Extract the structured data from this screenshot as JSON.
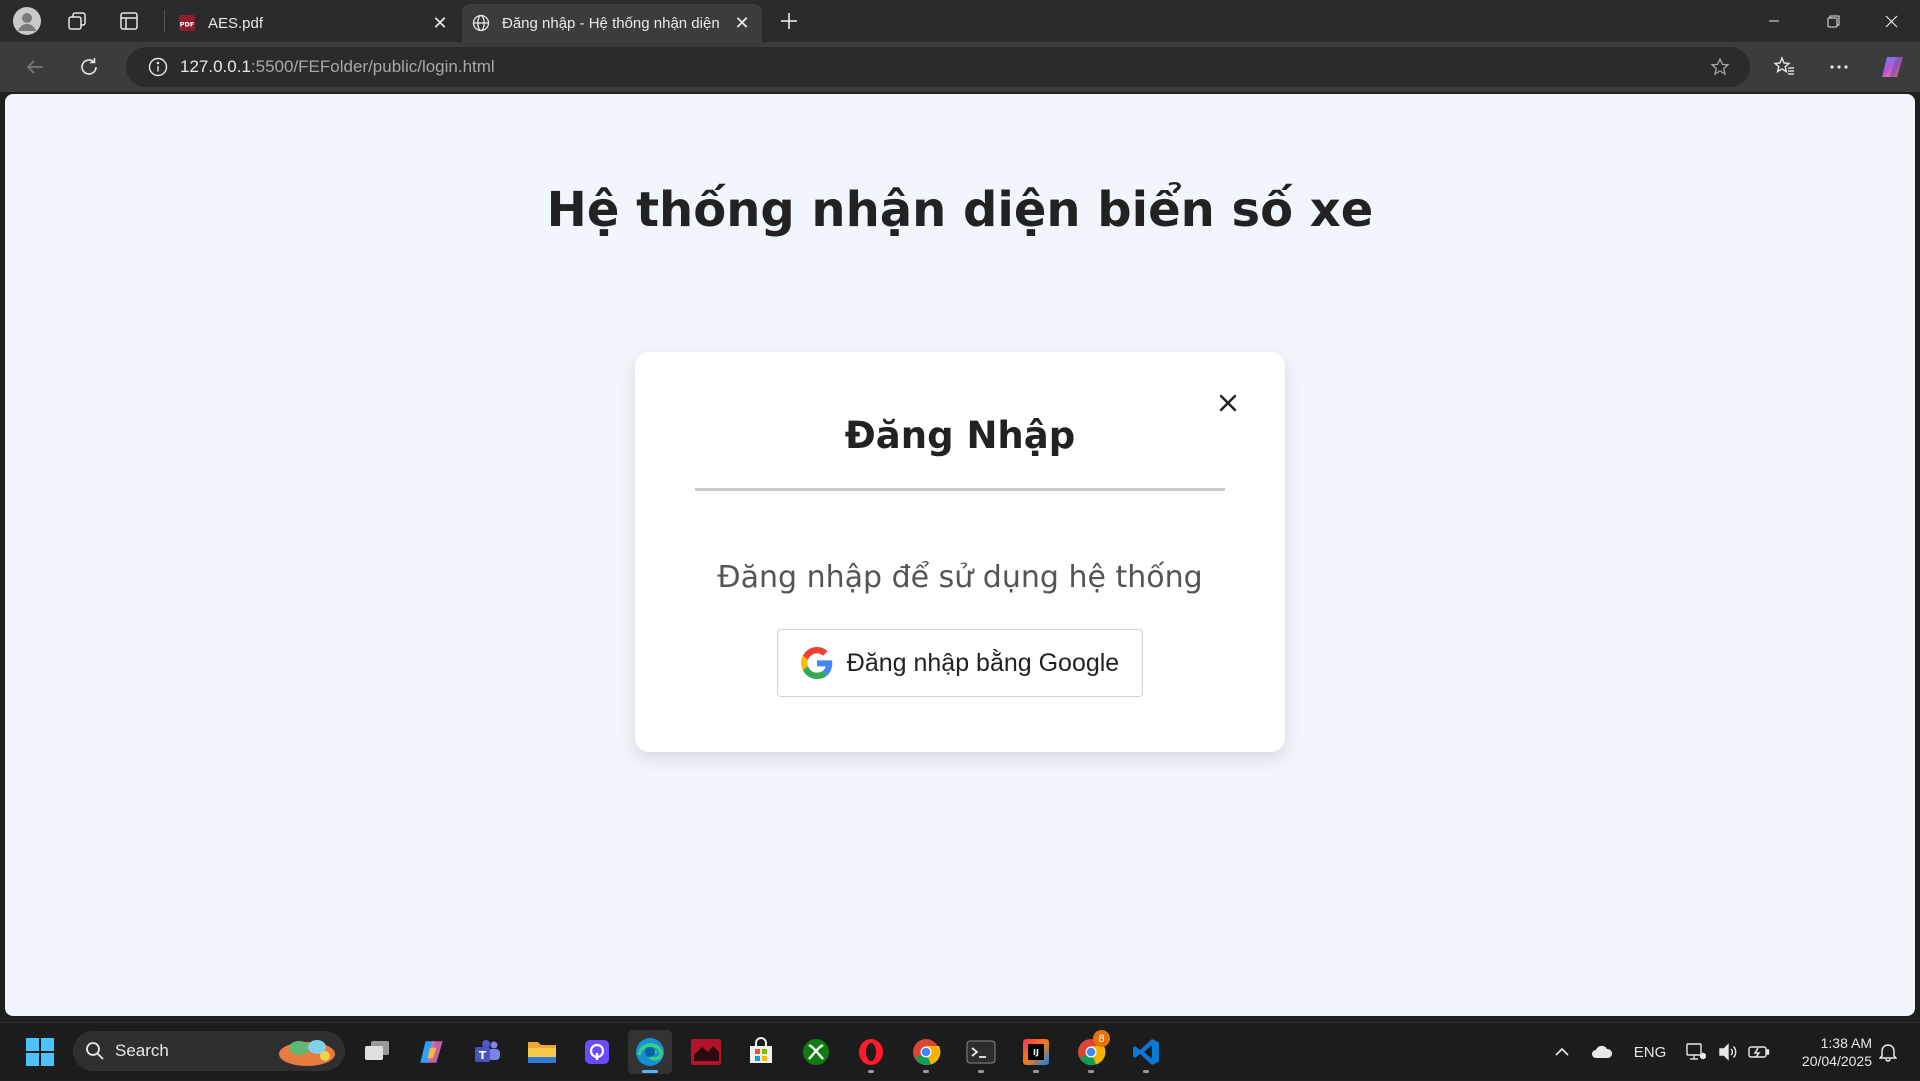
{
  "browser": {
    "tabs": [
      {
        "title": "AES.pdf",
        "favicon": "pdf-icon"
      },
      {
        "title": "Đăng nhập - Hệ thống nhận diện",
        "favicon": "globe-icon",
        "active": true
      }
    ],
    "address": {
      "host": "127.0.0.1",
      "rest": ":5500/FEFolder/public/login.html"
    }
  },
  "page": {
    "title": "Hệ thống nhận diện biển số xe",
    "modal": {
      "heading": "Đăng Nhập",
      "subtitle": "Đăng nhập để sử dụng hệ thống",
      "google_button": "Đăng nhập bằng Google"
    }
  },
  "taskbar": {
    "search_label": "Search",
    "badge_count": "8",
    "tray": {
      "language": "ENG",
      "time": "1:38 AM",
      "date": "20/04/2025"
    }
  },
  "colors": {
    "page_bg": "#f0f6fc",
    "card_bg": "#ffffff",
    "chrome_dark": "#2b2b2b",
    "toolbar": "#3c3c3c",
    "taskbar": "#1c1c1c"
  }
}
